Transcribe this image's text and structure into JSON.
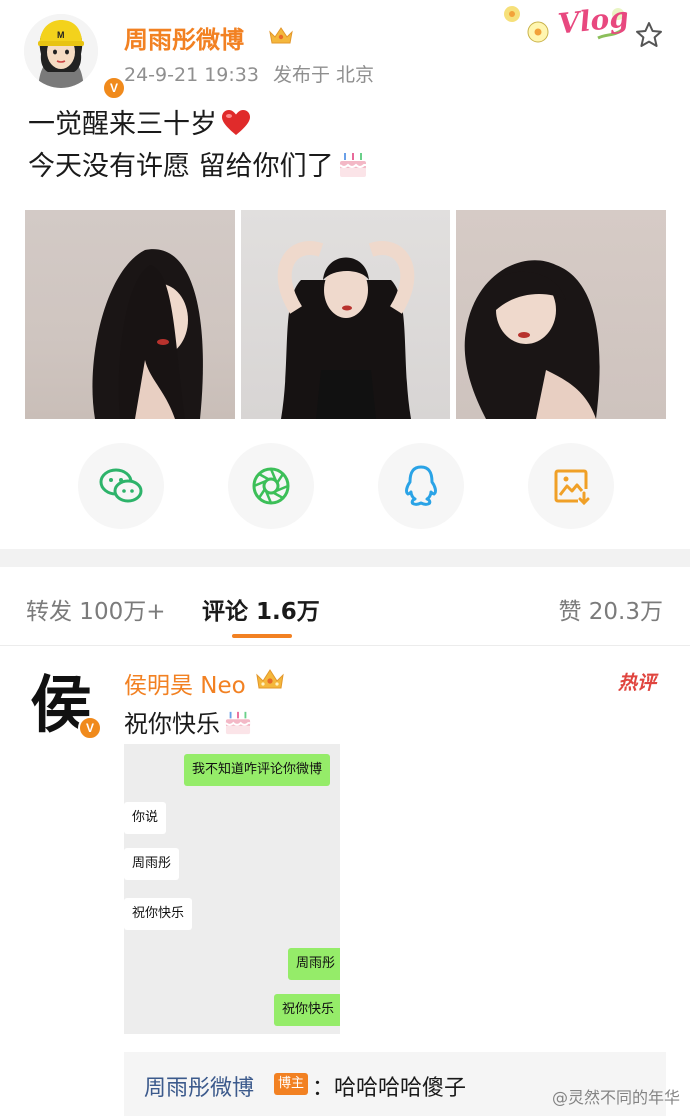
{
  "post": {
    "author": "周雨彤微博",
    "time": "24-9-21 19:33",
    "location_label": "发布于 北京",
    "sticker": "Vlog",
    "avatar_badge": "V",
    "text_line1": "一觉醒来三十岁",
    "text_line2": "今天没有许愿 留给你们了"
  },
  "share": {
    "items": [
      "wechat-icon",
      "moments-icon",
      "qq-icon",
      "save-image-icon"
    ]
  },
  "tabs": {
    "repost": "转发 100万+",
    "comments": "评论 1.6万",
    "likes": "赞 20.3万"
  },
  "comment": {
    "author": "侯明昊 Neo",
    "avatar_char": "侯",
    "avatar_badge": "V",
    "hot_label": "热评",
    "text": "祝你快乐"
  },
  "chat": {
    "messages": [
      {
        "side": "right",
        "text": "我不知道咋评论你微博"
      },
      {
        "side": "left",
        "text": "你说"
      },
      {
        "side": "left",
        "text": "周雨彤"
      },
      {
        "side": "left",
        "text": "祝你快乐"
      },
      {
        "side": "right",
        "text": "周雨彤"
      },
      {
        "side": "right",
        "text": "祝你快乐"
      }
    ]
  },
  "reply": {
    "author": "周雨彤微博",
    "badge": "博主",
    "text": "：哈哈哈哈傻子"
  },
  "watermark": "@灵然不同的年华",
  "colors": {
    "accent": "#f28122",
    "link": "#3c5a8c",
    "hot": "#e0453f",
    "chat_green": "#95ec69"
  }
}
